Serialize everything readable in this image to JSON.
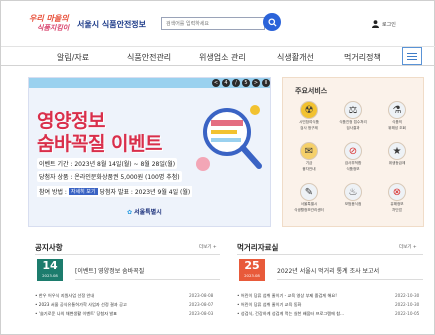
{
  "header": {
    "logo_line1": "우리 마을의",
    "logo_line2": "식품지킴이",
    "site_title": "서울시 식품안전정보",
    "search_placeholder": "검색어를 입력하세요",
    "login_label": "로그인"
  },
  "nav": {
    "items": [
      {
        "label": "알림/자료"
      },
      {
        "label": "식품안전관리"
      },
      {
        "label": "위생업소 관리"
      },
      {
        "label": "식생활개선"
      },
      {
        "label": "먹거리정책"
      }
    ]
  },
  "banner": {
    "controls": [
      "<",
      "4",
      "/",
      "5",
      ">",
      "II"
    ],
    "headline1": "영양정보",
    "headline2": "숨바꼭질 이벤트",
    "period": "이벤트 기간 : 2023년 8월 14일(월) ~ 8월 28일(월)",
    "prize": "당첨자 상품 : 온라인문화상품권 5,000원 (100명 추첨)",
    "howto": "참여 방법 :",
    "detail_label": "자세히 보기",
    "announce": "당첨자 발표 : 2023년 9월 4일 (월)",
    "sponsor": "서울특별시"
  },
  "services": {
    "title": "주요서비스",
    "items": [
      {
        "label1": "시민참여식품",
        "label2": "검사 청구제",
        "color": "#f2c230"
      },
      {
        "label1": "식품진정 접수처리",
        "label2": "검사결과",
        "color": "#eef2f6"
      },
      {
        "label1": "식품의",
        "label2": "위해성 조회",
        "color": "#eef2f6"
      },
      {
        "label1": "기금",
        "label2": "융자안내",
        "color": "#f5d06a"
      },
      {
        "label1": "검사부적합",
        "label2": "식품정보",
        "color": "#eef2f6"
      },
      {
        "label1": "위생등급제",
        "label2": "",
        "color": "#eef2f6"
      },
      {
        "label1": "서울특별시",
        "label2": "식생활정보관리센터",
        "color": "#eef2f6"
      },
      {
        "label1": "모범음식점",
        "label2": "",
        "color": "#eef2f6"
      },
      {
        "label1": "유해정보",
        "label2": "차단업",
        "color": "#eef2f6"
      }
    ]
  },
  "notice": {
    "title": "공지사항",
    "more": "더보기 +",
    "feature": {
      "day": "14",
      "ym": "2023.08",
      "text": "[이벤트] 영양정보 숨바꼭질"
    },
    "items": [
      {
        "text": "• 한우 어우식 지원사업 선정 안내",
        "date": "2023-08-08"
      },
      {
        "text": "• 2023 서울 공식유통허가학 사업자 선정 결과 공고",
        "date": "2023-08-07"
      },
      {
        "text": "• '슬기로운 나의 채변생활 이벤트' 당첨자 발표",
        "date": "2023-08-03"
      }
    ]
  },
  "data": {
    "title": "먹거리자료실",
    "more": "더보기 +",
    "feature": {
      "day": "25",
      "ym": "2023.08",
      "text": "2022년 서울시 먹거리 통계 조사 보고서"
    },
    "items": [
      {
        "text": "• 어린이 당류 섭취 줄이기 - 교육 영상 부제 즐겁게 해요!",
        "date": "2022-10-30"
      },
      {
        "text": "• 어린이 당류 섭취 줄이기 교육 동화",
        "date": "2022-10-30"
      },
      {
        "text": "• 성검식, 건강하게 성검게 먹는 실천 배움터 프로그램에 참...",
        "date": "2022-10-05"
      }
    ]
  },
  "colors": {
    "accent": "#2b63d9",
    "headline": "#d92f4b",
    "notice_badge": "#1c7c6d",
    "data_badge": "#e85a3a"
  }
}
